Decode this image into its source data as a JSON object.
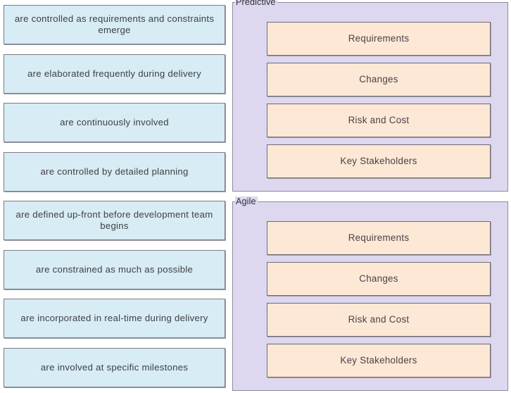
{
  "left_column": {
    "name": "answer-tiles",
    "tiles": [
      {
        "text": "are controlled as requirements and constraints emerge"
      },
      {
        "text": "are elaborated frequently during delivery"
      },
      {
        "text": "are continuously involved"
      },
      {
        "text": "are controlled by detailed planning"
      },
      {
        "text": "are defined up-front before development team begins"
      },
      {
        "text": "are constrained as much as possible"
      },
      {
        "text": "are incorporated in real-time during delivery"
      },
      {
        "text": "are involved at specific milestones"
      }
    ]
  },
  "panels": [
    {
      "title": "Predictive",
      "items": [
        {
          "label": "Requirements"
        },
        {
          "label": "Changes"
        },
        {
          "label": "Risk and Cost"
        },
        {
          "label": "Key Stakeholders"
        }
      ]
    },
    {
      "title": "Agile",
      "items": [
        {
          "label": "Requirements"
        },
        {
          "label": "Changes"
        },
        {
          "label": "Risk and Cost"
        },
        {
          "label": "Key Stakeholders"
        }
      ]
    }
  ],
  "colors": {
    "tile_fill": "#d7ecf4",
    "tile_border": "#7b7b85",
    "panel_fill": "#ddd8ef",
    "panel_border": "#8d8a9c",
    "item_fill": "#fce8d5",
    "item_border": "#6f6b72",
    "text": "#3f3f46",
    "background": "#ffffff"
  }
}
